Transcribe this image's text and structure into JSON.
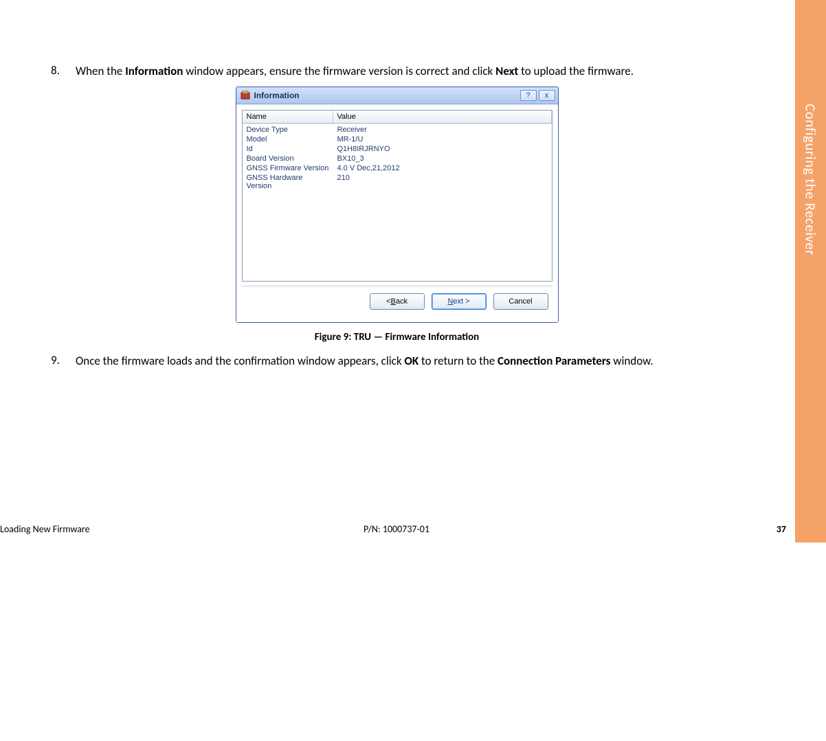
{
  "sideTab": "Configuring the Receiver",
  "step8": {
    "num": "8.",
    "t1": "When the ",
    "b1": "Information",
    "t2": " window appears, ensure the firmware version is correct and click ",
    "b2": "Next",
    "t3": " to upload the firmware."
  },
  "dialog": {
    "title": "Information",
    "helpGlyph": "?",
    "closeGlyph": "x",
    "headers": {
      "name": "Name",
      "value": "Value"
    },
    "rows": [
      {
        "name": "Device Type",
        "value": "Receiver"
      },
      {
        "name": "Model",
        "value": "MR-1/U"
      },
      {
        "name": "Id",
        "value": "Q1H8IRJRNYO"
      },
      {
        "name": "Board Version",
        "value": "BX10_3"
      },
      {
        "name": "GNSS Firmware Version",
        "value": "4.0 V Dec,21,2012"
      },
      {
        "name": "GNSS Hardware Version",
        "value": "210"
      }
    ],
    "buttons": {
      "back": {
        "pre": "< ",
        "u": "B",
        "post": "ack"
      },
      "next": {
        "u": "N",
        "post": "ext >"
      },
      "cancel": "Cancel"
    }
  },
  "caption": "Figure 9: TRU — Firmware Information",
  "step9": {
    "num": "9.",
    "t1": "Once the firmware loads and the confirmation window appears, click ",
    "b1": "OK",
    "t2": " to return to the ",
    "b2": "Connection Parameters",
    "t3": " window."
  },
  "footer": {
    "left": "Loading New Firmware",
    "center": "P/N: 1000737-01",
    "right": "37"
  }
}
